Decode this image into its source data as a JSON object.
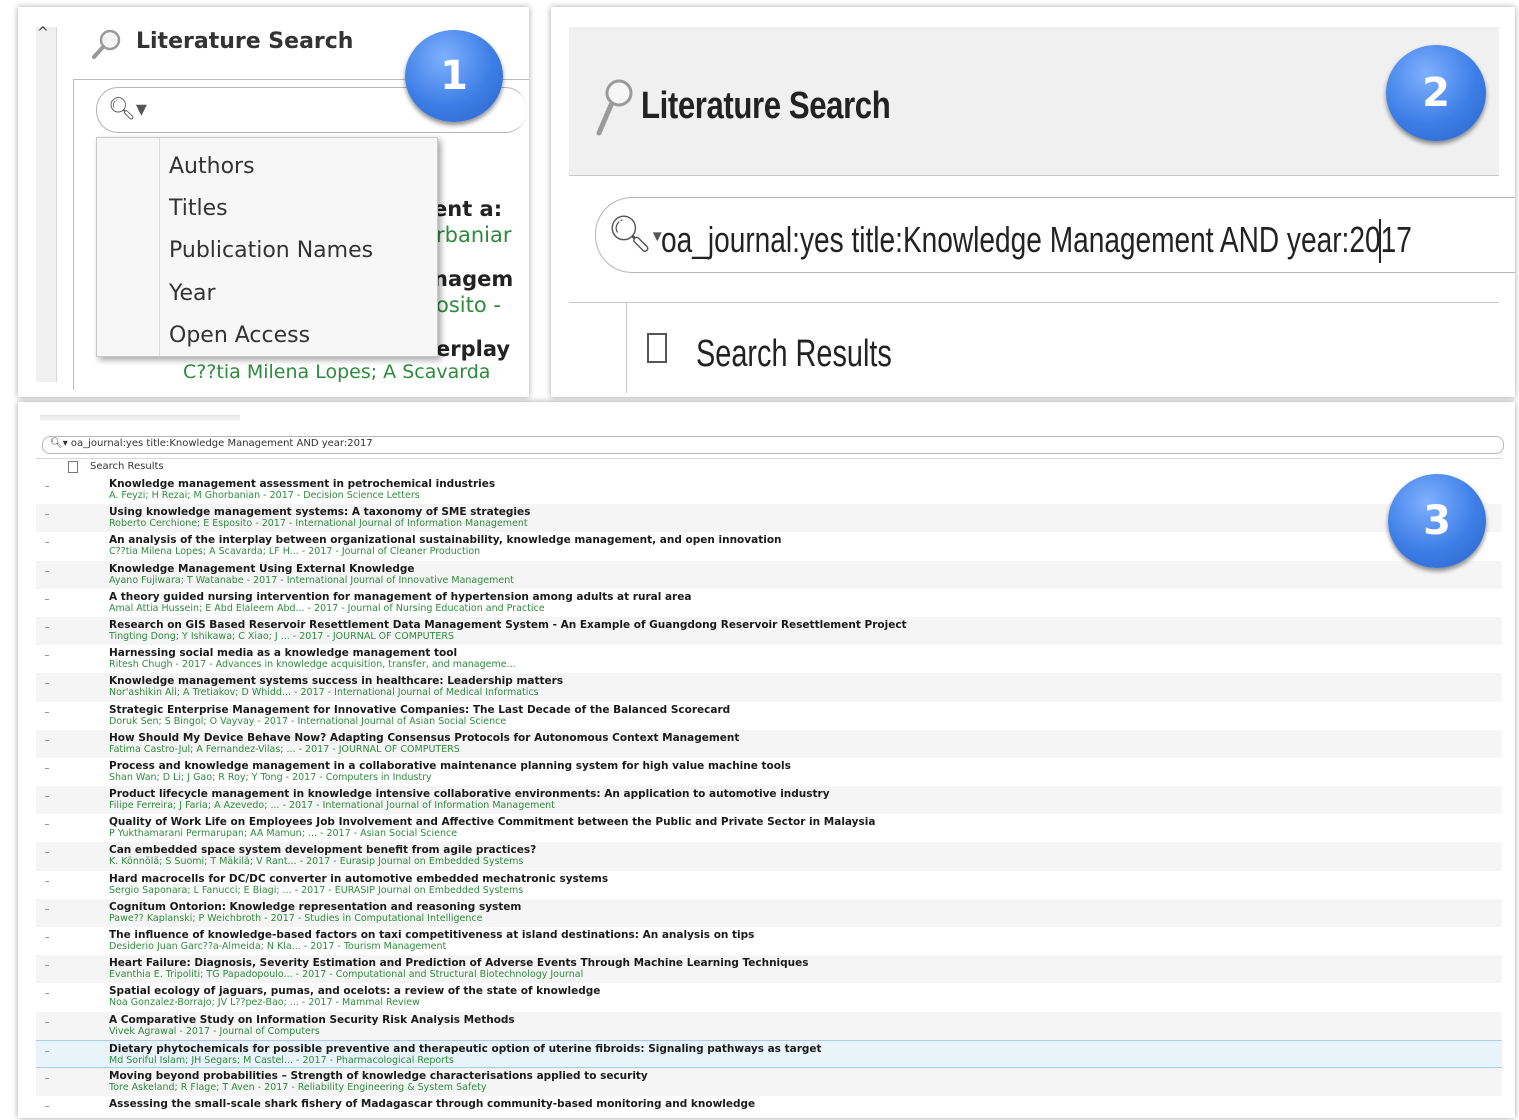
{
  "panel1": {
    "badge": "1",
    "title": "Literature Search",
    "menu": [
      "Authors",
      "Titles",
      "Publication Names",
      "Year",
      "Open Access"
    ],
    "behind": [
      "ent a:",
      "rbaniar",
      "nagem",
      "osito -",
      "erplay"
    ],
    "bottom_text": "C??tia Milena Lopes; A Scavarda"
  },
  "panel2": {
    "badge": "2",
    "title": "Literature Search",
    "query": "oa_journal:yes title:Knowledge Management AND year:2017",
    "results_label": "Search Results"
  },
  "panel3": {
    "badge": "3",
    "query": "oa_journal:yes title:Knowledge Management AND year:2017",
    "results_label": "Search Results",
    "results": [
      {
        "title": "Knowledge management assessment in petrochemical industries",
        "meta": "A. Feyzi; H Rezai; M Ghorbanian - 2017 - Decision Science Letters"
      },
      {
        "title": "Using knowledge management systems: A taxonomy of SME strategies",
        "meta": "Roberto Cerchione; E Esposito - 2017 - International Journal of Information Management"
      },
      {
        "title": "An analysis of the interplay between organizational sustainability, knowledge management, and open innovation",
        "meta": "C??tia Milena Lopes; A Scavarda; LF H... - 2017 - Journal of Cleaner Production"
      },
      {
        "title": "Knowledge Management Using External Knowledge",
        "meta": "Ayano Fujiwara; T Watanabe - 2017 - International Journal of Innovative Management"
      },
      {
        "title": "A theory guided nursing intervention for management of hypertension among adults at rural area",
        "meta": "Amal Attia Hussein; E Abd Elaleem Abd... - 2017 - Journal of Nursing Education and Practice"
      },
      {
        "title": "Research on GIS Based Reservoir Resettlement Data Management System - An Example of Guangdong Reservoir Resettlement Project",
        "meta": "Tingting Dong; Y Ishikawa; C Xiao; J ... - 2017 - JOURNAL OF COMPUTERS"
      },
      {
        "title": "Harnessing social media as a knowledge management tool",
        "meta": "Ritesh Chugh - 2017 - Advances in knowledge acquisition, transfer, and manageme..."
      },
      {
        "title": "Knowledge management systems success in healthcare: Leadership matters",
        "meta": "Nor'ashikin Ali; A Tretiakov; D Whidd... - 2017 - International Journal of Medical Informatics"
      },
      {
        "title": "Strategic Enterprise Management for Innovative Companies: The Last Decade of the Balanced Scorecard",
        "meta": "Doruk Sen; S Bingol; O Vayvay - 2017 - International Journal of Asian Social Science"
      },
      {
        "title": "How Should My Device Behave Now? Adapting Consensus Protocols for Autonomous Context Management",
        "meta": "Fatima Castro-Jul; A Fernandez-Vilas; ... - 2017 - JOURNAL OF COMPUTERS"
      },
      {
        "title": "Process and knowledge management in a collaborative maintenance planning system for high value machine tools",
        "meta": "Shan Wan; D Li; J Gao; R Roy; Y Tong - 2017 - Computers in Industry"
      },
      {
        "title": "Product lifecycle management in knowledge intensive collaborative environments: An application to automotive industry",
        "meta": "Filipe Ferreira; J Faria; A Azevedo; ... - 2017 - International Journal of Information Management"
      },
      {
        "title": "Quality of Work Life on Employees Job Involvement and Affective Commitment between the Public and Private Sector in Malaysia",
        "meta": "P Yukthamarani Permarupan; AA Mamun; ... - 2017 - Asian Social Science"
      },
      {
        "title": "Can embedded space system development benefit from agile practices?",
        "meta": "K. Könnölä; S Suomi; T Mäkilä; V Rant... - 2017 - Eurasip Journal on Embedded Systems"
      },
      {
        "title": "Hard macrocells for DC/DC converter in automotive embedded mechatronic systems",
        "meta": "Sergio Saponara; L Fanucci; E Biagi; ... - 2017 - EURASIP Journal on Embedded Systems"
      },
      {
        "title": "Cognitum Ontorion: Knowledge representation and reasoning system",
        "meta": "Pawe?? Kaplanski; P Weichbroth - 2017 - Studies in Computational Intelligence"
      },
      {
        "title": "The influence of knowledge-based factors on taxi competitiveness at island destinations: An analysis on tips",
        "meta": "Desiderio Juan Garc??a-Almeida; N Kla... - 2017 - Tourism Management"
      },
      {
        "title": "Heart Failure: Diagnosis, Severity Estimation and Prediction of Adverse Events Through Machine Learning Techniques",
        "meta": "Evanthia E. Tripoliti; TG Papadopoulo... - 2017 - Computational and Structural Biotechnology Journal"
      },
      {
        "title": "Spatial ecology of jaguars, pumas, and ocelots: a review of the state of knowledge",
        "meta": "Noa Gonzalez-Borrajo; JV L??pez-Bao; ... - 2017 - Mammal Review"
      },
      {
        "title": "A Comparative Study on Information Security Risk Analysis Methods",
        "meta": "Vivek Agrawal - 2017 - Journal of Computers"
      },
      {
        "title": "Dietary phytochemicals for possible preventive and therapeutic option of uterine fibroids: Signaling pathways as target",
        "meta": "Md Soriful Islam; JH Segars; M Castel... - 2017 - Pharmacological Reports"
      },
      {
        "title": "Moving beyond probabilities – Strength of knowledge characterisations applied to security",
        "meta": "Tore Askeland; R Flage; T Aven - 2017 - Reliability Engineering & System Safety"
      },
      {
        "title": "Assessing the small-scale shark fishery of Madagascar through community-based monitoring and knowledge",
        "meta": ""
      }
    ]
  },
  "colors": {
    "badge": "#3d7ee6",
    "meta_text": "#2e8b3d",
    "selected_row": "#e8f3fa"
  }
}
